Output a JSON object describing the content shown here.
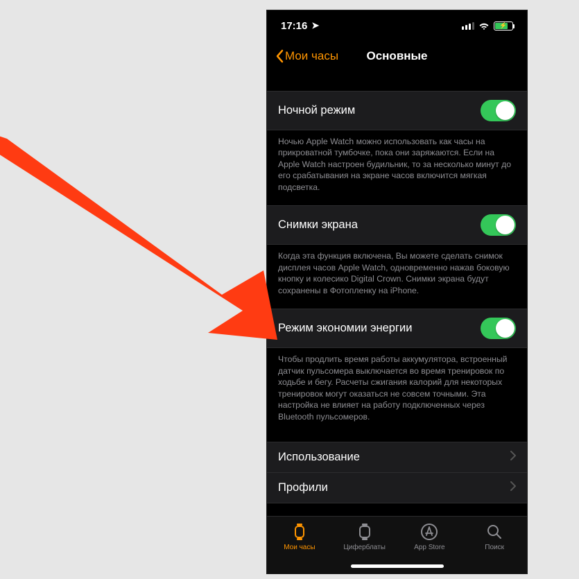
{
  "statusbar": {
    "time": "17:16"
  },
  "header": {
    "back": "Мои часы",
    "title": "Основные"
  },
  "settings": [
    {
      "label": "Ночной режим",
      "desc": "Ночью Apple Watch можно использовать как часы на прикроватной тумбочке, пока они заряжаются. Если на Apple Watch настроен будильник, то за несколько минут до его срабатывания на экране часов включится мягкая подсветка."
    },
    {
      "label": "Снимки экрана",
      "desc": "Когда эта функция включена, Вы можете сделать снимок дисплея часов Apple Watch, одновременно нажав боковую кнопку и колесико Digital Crown. Снимки экрана будут сохранены в Фотопленку на iPhone."
    },
    {
      "label": "Режим экономии энергии",
      "desc": "Чтобы продлить время работы аккумулятора, встроенный датчик пульсомера выключается во время тренировок по ходьбе и бегу. Расчеты сжигания калорий для некоторых тренировок могут оказаться не совсем точными. Эта настройка не влияет на работу подключенных через Bluetooth пульсомеров."
    }
  ],
  "navitems": [
    {
      "label": "Использование"
    },
    {
      "label": "Профили"
    }
  ],
  "tabs": [
    {
      "label": "Мои часы"
    },
    {
      "label": "Циферблаты"
    },
    {
      "label": "App Store"
    },
    {
      "label": "Поиск"
    }
  ]
}
